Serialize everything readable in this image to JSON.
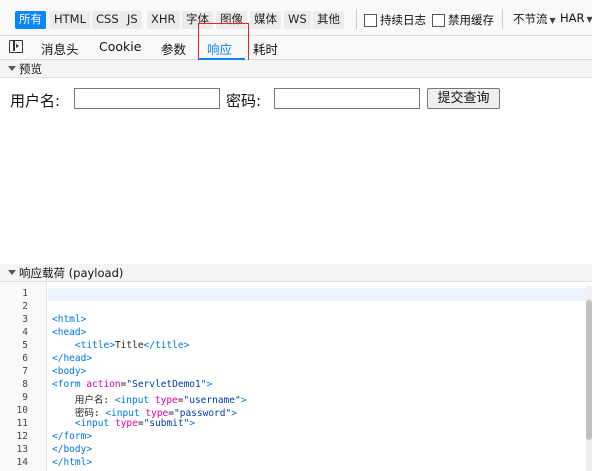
{
  "filter_bar": {
    "type_filters": [
      {
        "label": "所有",
        "active": true
      },
      {
        "label": "HTML",
        "active": false
      },
      {
        "label": "CSS",
        "active": false
      },
      {
        "label": "JS",
        "active": false
      },
      {
        "label": "XHR",
        "active": false
      },
      {
        "label": "字体",
        "active": false
      },
      {
        "label": "图像",
        "active": false
      },
      {
        "label": "媒体",
        "active": false
      },
      {
        "label": "WS",
        "active": false
      },
      {
        "label": "其他",
        "active": false
      }
    ],
    "persist_logs": {
      "label": "持续日志",
      "checked": false
    },
    "disable_cache": {
      "label": "禁用缓存",
      "checked": false
    },
    "throttling": "不节流",
    "har": "HAR"
  },
  "tabs": [
    {
      "label": "消息头",
      "active": false
    },
    {
      "label": "Cookie",
      "active": false
    },
    {
      "label": "参数",
      "active": false
    },
    {
      "label": "响应",
      "active": true
    },
    {
      "label": "耗时",
      "active": false
    }
  ],
  "preview": {
    "header": "预览",
    "username_label": "用户名:",
    "username_value": "",
    "password_label": "密码:",
    "password_value": "",
    "submit_label": "提交查询"
  },
  "payload": {
    "header": "响应载荷 (payload)",
    "lines": [
      {
        "n": "1",
        "code": []
      },
      {
        "n": "2",
        "code": []
      },
      {
        "n": "3",
        "code": [
          [
            "t",
            "<html>"
          ]
        ]
      },
      {
        "n": "4",
        "code": [
          [
            "t",
            "<head>"
          ]
        ]
      },
      {
        "n": "5",
        "code": [
          [
            "p",
            "    "
          ],
          [
            "t",
            "<title>"
          ],
          [
            "p",
            "Title"
          ],
          [
            "t",
            "</title>"
          ]
        ]
      },
      {
        "n": "6",
        "code": [
          [
            "t",
            "</head>"
          ]
        ]
      },
      {
        "n": "7",
        "code": [
          [
            "t",
            "<body>"
          ]
        ]
      },
      {
        "n": "8",
        "code": [
          [
            "t",
            "<form "
          ],
          [
            "a",
            "action"
          ],
          [
            "p",
            "="
          ],
          [
            "s",
            "\"ServletDemo1\""
          ],
          [
            "t",
            ">"
          ]
        ]
      },
      {
        "n": "9",
        "code": [
          [
            "p",
            "    用户名: "
          ],
          [
            "t",
            "<input "
          ],
          [
            "a",
            "type"
          ],
          [
            "p",
            "="
          ],
          [
            "s",
            "\"username\""
          ],
          [
            "t",
            ">"
          ]
        ]
      },
      {
        "n": "10",
        "code": [
          [
            "p",
            "    密码: "
          ],
          [
            "t",
            "<input "
          ],
          [
            "a",
            "type"
          ],
          [
            "p",
            "="
          ],
          [
            "s",
            "\"password\""
          ],
          [
            "t",
            ">"
          ]
        ]
      },
      {
        "n": "11",
        "code": [
          [
            "p",
            "    "
          ],
          [
            "t",
            "<input "
          ],
          [
            "a",
            "type"
          ],
          [
            "p",
            "="
          ],
          [
            "s",
            "\"submit\""
          ],
          [
            "t",
            ">"
          ]
        ]
      },
      {
        "n": "12",
        "code": [
          [
            "t",
            "</form>"
          ]
        ]
      },
      {
        "n": "13",
        "code": [
          [
            "t",
            "</body>"
          ]
        ]
      },
      {
        "n": "14",
        "code": [
          [
            "t",
            "</html>"
          ]
        ]
      }
    ]
  },
  "colors": {
    "accent": "#0a84ff",
    "tag": "#0074e8",
    "attr": "#dd00a9",
    "string": "#003eaa",
    "highlight_box": "#ee2222"
  }
}
